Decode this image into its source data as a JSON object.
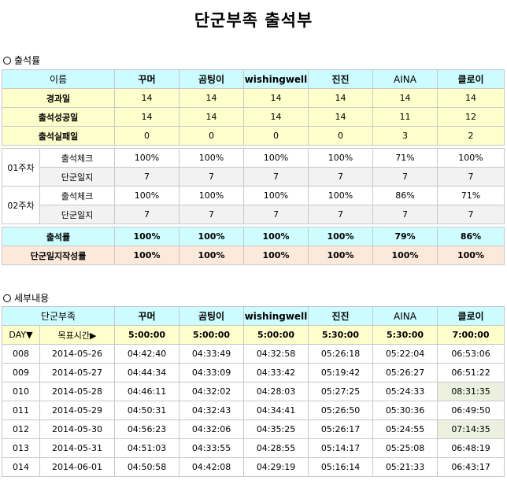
{
  "title": "단군부족 출석부",
  "attendance": {
    "heading": "출석률",
    "columns": [
      "이름",
      "꾸머",
      "곰팅이",
      "wishingwell",
      "진진",
      "AINA",
      "클로이"
    ],
    "elapsed": {
      "label": "경과일",
      "values": [
        "14",
        "14",
        "14",
        "14",
        "14",
        "14"
      ]
    },
    "success": {
      "label": "출석성공일",
      "values": [
        "14",
        "14",
        "14",
        "14",
        "11",
        "12"
      ]
    },
    "fail": {
      "label": "출석실패일",
      "values": [
        "0",
        "0",
        "0",
        "0",
        "3",
        "2"
      ]
    },
    "weeks": [
      {
        "label": "01주차",
        "check": {
          "label": "출석체크",
          "values": [
            "100%",
            "100%",
            "100%",
            "100%",
            "71%",
            "100%"
          ]
        },
        "journal": {
          "label": "단군일지",
          "values": [
            "7",
            "7",
            "7",
            "7",
            "7",
            "7"
          ]
        }
      },
      {
        "label": "02주차",
        "check": {
          "label": "출석체크",
          "values": [
            "100%",
            "100%",
            "100%",
            "100%",
            "86%",
            "71%"
          ]
        },
        "journal": {
          "label": "단군일지",
          "values": [
            "7",
            "7",
            "7",
            "7",
            "7",
            "7"
          ]
        }
      }
    ],
    "rate": {
      "label": "출석률",
      "values": [
        "100%",
        "100%",
        "100%",
        "100%",
        "79%",
        "86%"
      ]
    },
    "journal_rate": {
      "label": "단군일지작성률",
      "values": [
        "100%",
        "100%",
        "100%",
        "100%",
        "100%",
        "100%"
      ]
    }
  },
  "details": {
    "heading": "세부내용",
    "header_label": "단군부족",
    "names": [
      "꾸머",
      "곰팅이",
      "wishingwell",
      "진진",
      "AINA",
      "클로이"
    ],
    "day_label": "DAY▼",
    "target_label": "목표시간▶",
    "targets": [
      "5:00:00",
      "5:00:00",
      "5:00:00",
      "5:30:00",
      "5:30:00",
      "7:00:00"
    ],
    "rows": [
      {
        "day": "008",
        "date": "2014-05-26",
        "times": [
          "04:42:40",
          "04:33:49",
          "04:32:58",
          "05:26:18",
          "05:22:04",
          "06:53:06"
        ]
      },
      {
        "day": "009",
        "date": "2014-05-27",
        "times": [
          "04:44:34",
          "04:33:09",
          "04:33:42",
          "05:19:42",
          "05:26:27",
          "06:51:22"
        ]
      },
      {
        "day": "010",
        "date": "2014-05-28",
        "times": [
          "04:46:11",
          "04:32:02",
          "04:28:03",
          "05:27:25",
          "05:24:33",
          "08:31:35"
        ]
      },
      {
        "day": "011",
        "date": "2014-05-29",
        "times": [
          "04:50:31",
          "04:32:43",
          "04:34:41",
          "05:26:50",
          "05:30:36",
          "06:49:50"
        ]
      },
      {
        "day": "012",
        "date": "2014-05-30",
        "times": [
          "04:56:23",
          "04:32:06",
          "04:35:25",
          "05:26:17",
          "05:24:55",
          "07:14:35"
        ]
      },
      {
        "day": "013",
        "date": "2014-05-31",
        "times": [
          "04:51:03",
          "04:33:55",
          "04:28:55",
          "05:14:17",
          "05:25:08",
          "06:48:19"
        ]
      },
      {
        "day": "014",
        "date": "2014-06-01",
        "times": [
          "04:50:58",
          "04:42:08",
          "04:29:19",
          "05:16:14",
          "05:21:33",
          "06:43:17"
        ]
      }
    ]
  }
}
